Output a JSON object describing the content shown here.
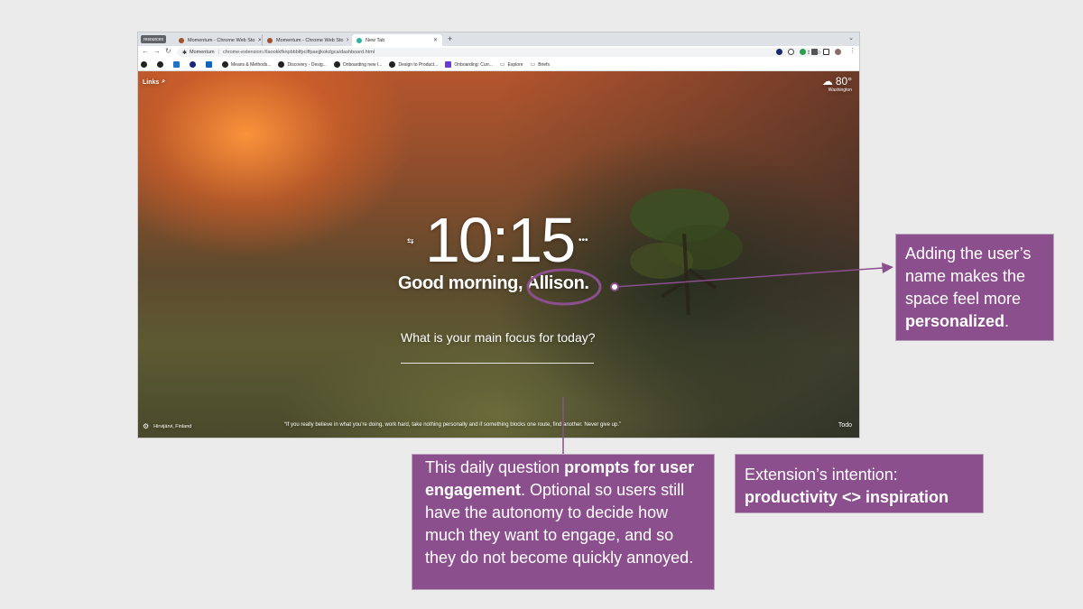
{
  "browser": {
    "tab_group": "resources",
    "tabs": [
      {
        "title": "Momentum - Chrome Web Sto",
        "active": false
      },
      {
        "title": "Momentum - Chrome Web Sto",
        "active": false
      },
      {
        "title": "New Tab",
        "active": true
      }
    ],
    "new_tab": "+",
    "omnibox": {
      "site": "Momentum",
      "url": "chrome-extension://laookkfknpbbblfpciffpaejjkokdgca/dashboard.html"
    },
    "bookmarks": [
      {
        "label": "",
        "icon": "bookmark-a-icon"
      },
      {
        "label": "",
        "icon": "bookmark-b-icon"
      },
      {
        "label": "",
        "icon": "bookmark-c-icon"
      },
      {
        "label": "",
        "icon": "bookmark-d-icon"
      },
      {
        "label": "",
        "icon": "linkedin-icon"
      },
      {
        "label": "Means & Methods...",
        "icon": "bookmark-icon"
      },
      {
        "label": "Discovery - Desig...",
        "icon": "bookmark-icon"
      },
      {
        "label": "Onboarding new I...",
        "icon": "bookmark-icon"
      },
      {
        "label": "Design to Product...",
        "icon": "bookmark-icon"
      },
      {
        "label": "Onboarding: Curr...",
        "icon": "bookmark-icon"
      },
      {
        "label": "Explore",
        "icon": "folder-icon"
      },
      {
        "label": "Briefs",
        "icon": "folder-icon"
      }
    ]
  },
  "dashboard": {
    "links_label": "Links",
    "weather": {
      "temp": "80°",
      "location": "Washington"
    },
    "time": "10:15",
    "greeting": "Good morning, Allison.",
    "focus_question": "What is your main focus for today?",
    "photo_location": "Hirvijärvi, Finland",
    "quote": "“If you really believe in what you're doing, work hard, take nothing personally and if something blocks one route, find another. Never give up.”",
    "todo_label": "Todo"
  },
  "callouts": {
    "name": {
      "text_1": "Adding the user’s name makes the space feel more ",
      "bold": "personalized",
      "text_2": "."
    },
    "question": {
      "text_1": "This daily question ",
      "bold_1": "prompts for user engagement",
      "text_2": ". Optional so users still have the autonomy to decide how much they want to engage, and so they do not become quickly annoyed."
    },
    "intent": {
      "line_1": "Extension’s intention:",
      "bold": "productivity <> inspiration"
    }
  },
  "colors": {
    "callout_bg": "#8b4f8d",
    "callout_border": "#b7a4b8",
    "annotation_line": "#8b4f8d",
    "slide_bg": "#ebebeb"
  }
}
